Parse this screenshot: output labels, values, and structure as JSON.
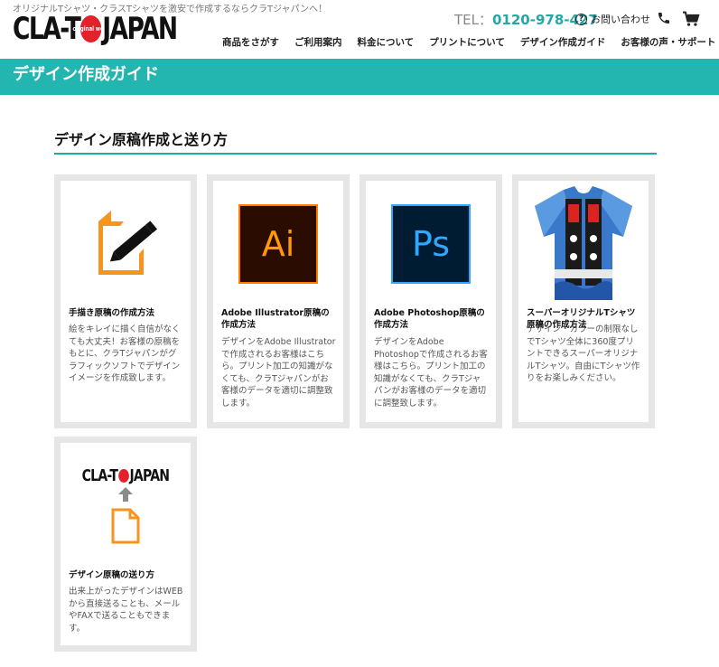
{
  "header": {
    "tagline": "オリジナルTシャツ・クラスTシャツを激安で作成するならクラTジャパンへ！",
    "logo_left": "CLA-T",
    "logo_badge": "original wear",
    "logo_right": "JAPAN",
    "tel_label": "TEL：",
    "tel_number": "0120-978-427",
    "contact_label": "お問い合わせ"
  },
  "nav": [
    {
      "label": "商品をさがす"
    },
    {
      "label": "ご利用案内"
    },
    {
      "label": "料金について"
    },
    {
      "label": "プリントについて"
    },
    {
      "label": "デザイン作成ガイド"
    },
    {
      "label": "お客様の声・サポート"
    }
  ],
  "banner": {
    "title": "デザイン作成ガイド"
  },
  "section": {
    "title": "デザイン原稿作成と送り方"
  },
  "cards": [
    {
      "title": "手描き原稿の作成方法",
      "desc": "絵をキレイに描く自信がなくても大丈夫！お客様の原稿をもとに、クラTジャパンがグラフィックソフトでデザインイメージを作成致します。"
    },
    {
      "title": "Adobe Illustrator原稿の作成方法",
      "icon_text": "Ai",
      "desc": "デザインをAdobe Illustratorで作成されるお客様はこちら。プリント加工の知識がなくても、クラTジャパンがお客様のデータを適切に調整致します。"
    },
    {
      "title": "Adobe Photoshop原稿の作成方法",
      "icon_text": "Ps",
      "desc": "デザインをAdobe Photoshopで作成されるお客様はこちら。プリント加工の知識がなくても、クラTジャパンがお客様のデータを適切に調整致します。"
    },
    {
      "title": "スーパーオリジナルTシャツ原稿の作成方法",
      "desc": "デザイン・カラーの制限なしでTシャツ全体に360度プリントできるスーパーオリジナルTシャツ。自由にTシャツ作りをお楽しみください。"
    },
    {
      "title": "デザイン原稿の送り方",
      "logo_left": "CLA-T",
      "logo_right": "JAPAN",
      "desc": "出来上がったデザインはWEBから直接送ることも、メールやFAXで送ることもできます。"
    }
  ],
  "colors": {
    "accent": "#23b5b0",
    "accent_dark": "#23a9a5",
    "brand_red": "#e4202b",
    "card_border": "#e6e6e6",
    "orange": "#f7941d"
  }
}
